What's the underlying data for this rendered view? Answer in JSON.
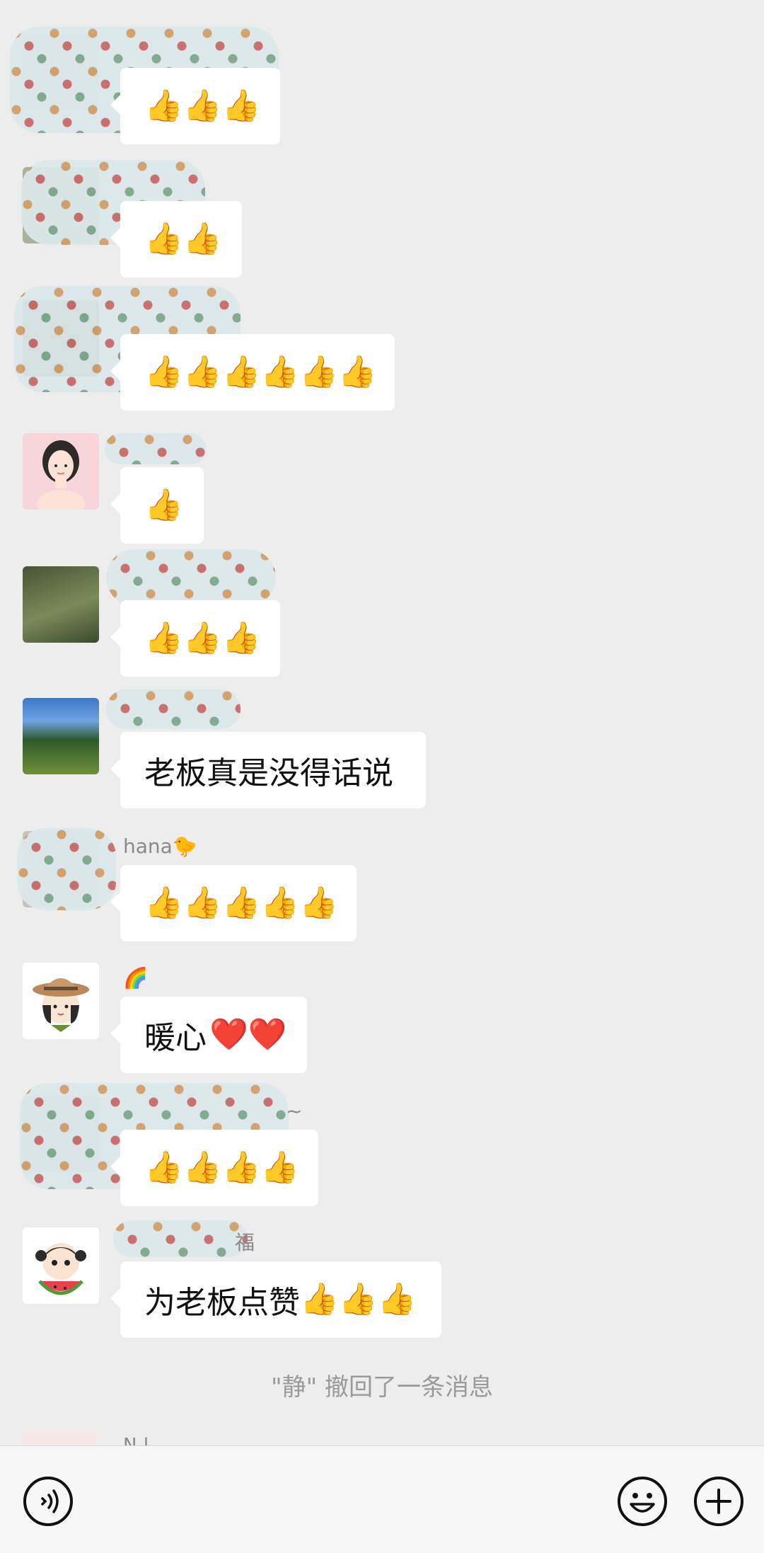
{
  "chat": {
    "messages": [
      {
        "name": "",
        "text": "",
        "emoji": "👍👍👍"
      },
      {
        "name": "",
        "text": "",
        "emoji": "👍👍"
      },
      {
        "name": "",
        "text": "",
        "emoji": "👍👍👍👍👍👍"
      },
      {
        "name": "",
        "text": "",
        "emoji": "👍"
      },
      {
        "name": "",
        "text": "",
        "emoji": "👍👍👍"
      },
      {
        "name": "",
        "text": "老板真是没得话说",
        "emoji": ""
      },
      {
        "name": "hana🐤",
        "text": "",
        "emoji": "👍👍👍👍👍"
      },
      {
        "name": "🌈",
        "text": "暖心",
        "emoji": "❤️❤️"
      },
      {
        "name": "~",
        "text": "",
        "emoji": "👍👍👍👍"
      },
      {
        "name": "福",
        "text": "为老板点赞",
        "emoji": "👍👍👍"
      }
    ],
    "recall_notice": "\"静\" 撤回了一条消息",
    "partial_name": "N-l-"
  },
  "input_bar": {
    "voice_icon": "voice-icon",
    "emoji_icon": "emoji-icon",
    "plus_icon": "plus-icon"
  },
  "colors": {
    "background": "#EDEDED",
    "bubble": "#FFFFFF",
    "name_text": "#8A8A8A",
    "recall_text": "#9A9A9A"
  }
}
